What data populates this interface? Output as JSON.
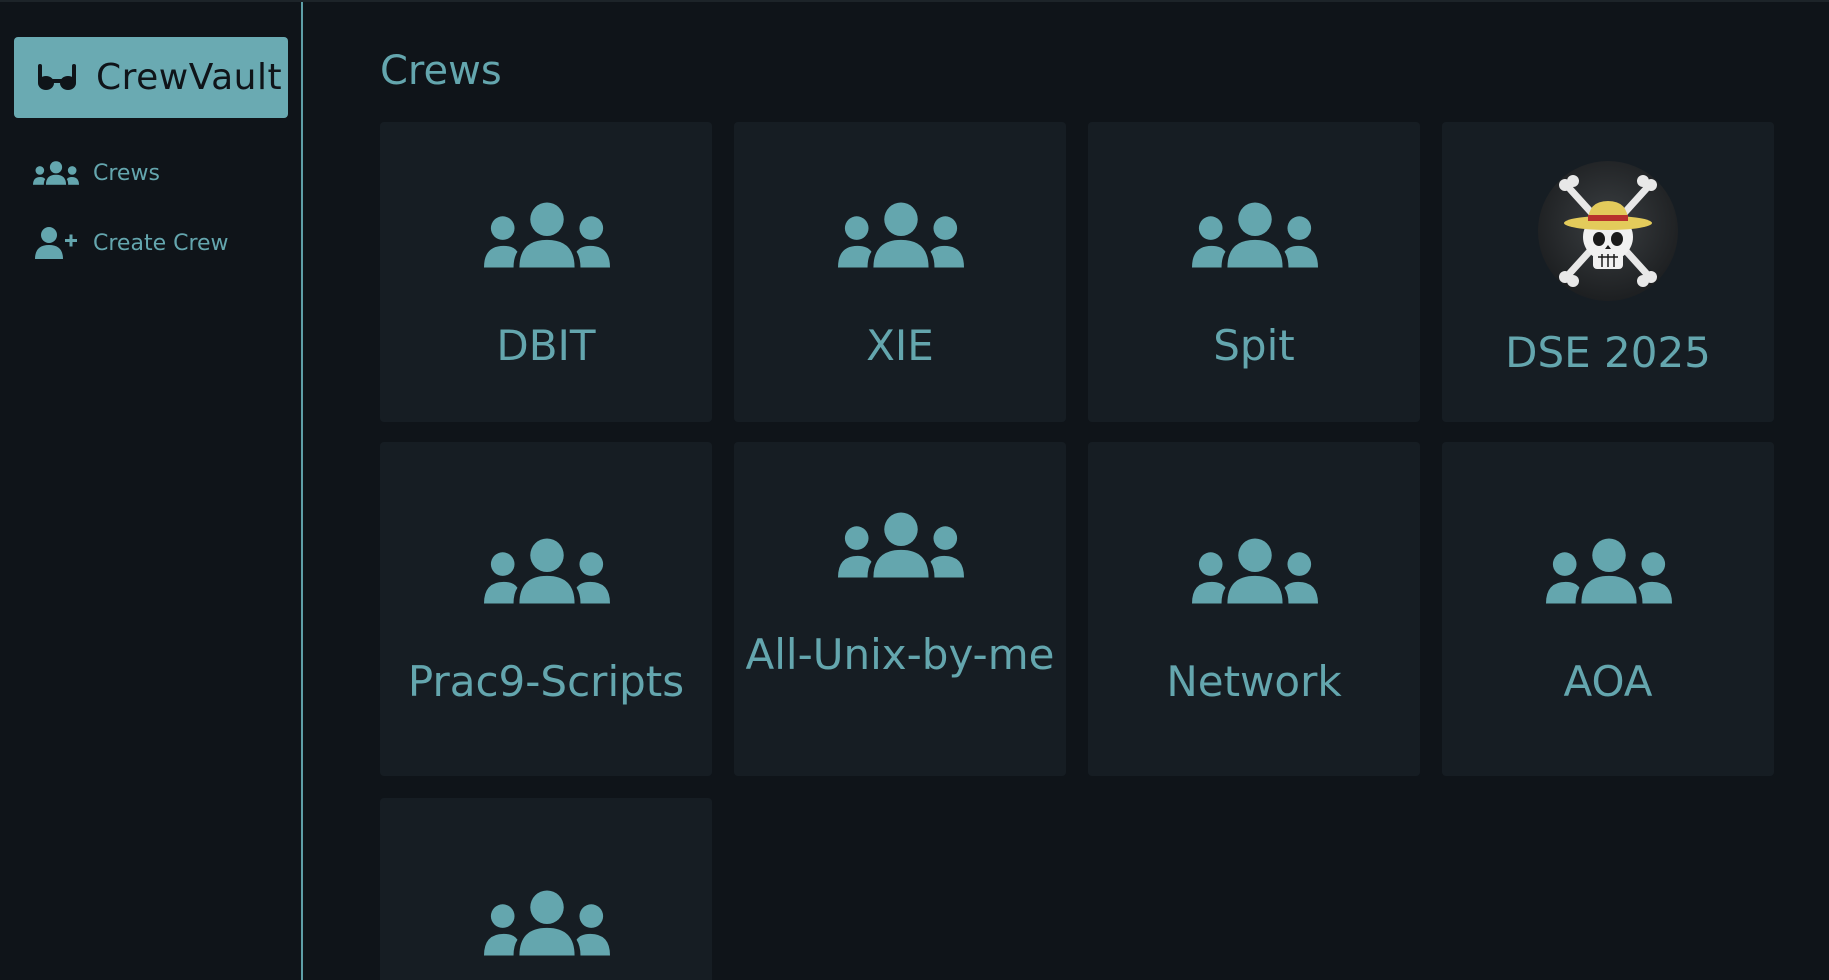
{
  "app": {
    "name": "CrewVault",
    "logo_icon": "glasses-icon",
    "accent_color": "#6aaab2",
    "background_color": "#0f1419",
    "card_color": "#161d23"
  },
  "sidebar": {
    "items": [
      {
        "label": "Crews",
        "icon": "users-icon"
      },
      {
        "label": "Create Crew",
        "icon": "user-plus-icon"
      }
    ]
  },
  "main": {
    "title": "Crews",
    "crews": [
      {
        "name": "DBIT",
        "icon": "users-icon"
      },
      {
        "name": "XIE",
        "icon": "users-icon"
      },
      {
        "name": "Spit",
        "icon": "users-icon"
      },
      {
        "name": "DSE 2025",
        "icon": "jolly-roger-straw-hat-image"
      },
      {
        "name": "Prac9-Scripts",
        "icon": "users-icon"
      },
      {
        "name": "All-Unix-by-me",
        "icon": "users-icon"
      },
      {
        "name": "Network",
        "icon": "users-icon"
      },
      {
        "name": "AOA",
        "icon": "users-icon"
      },
      {
        "name": "",
        "icon": "users-icon"
      }
    ]
  }
}
